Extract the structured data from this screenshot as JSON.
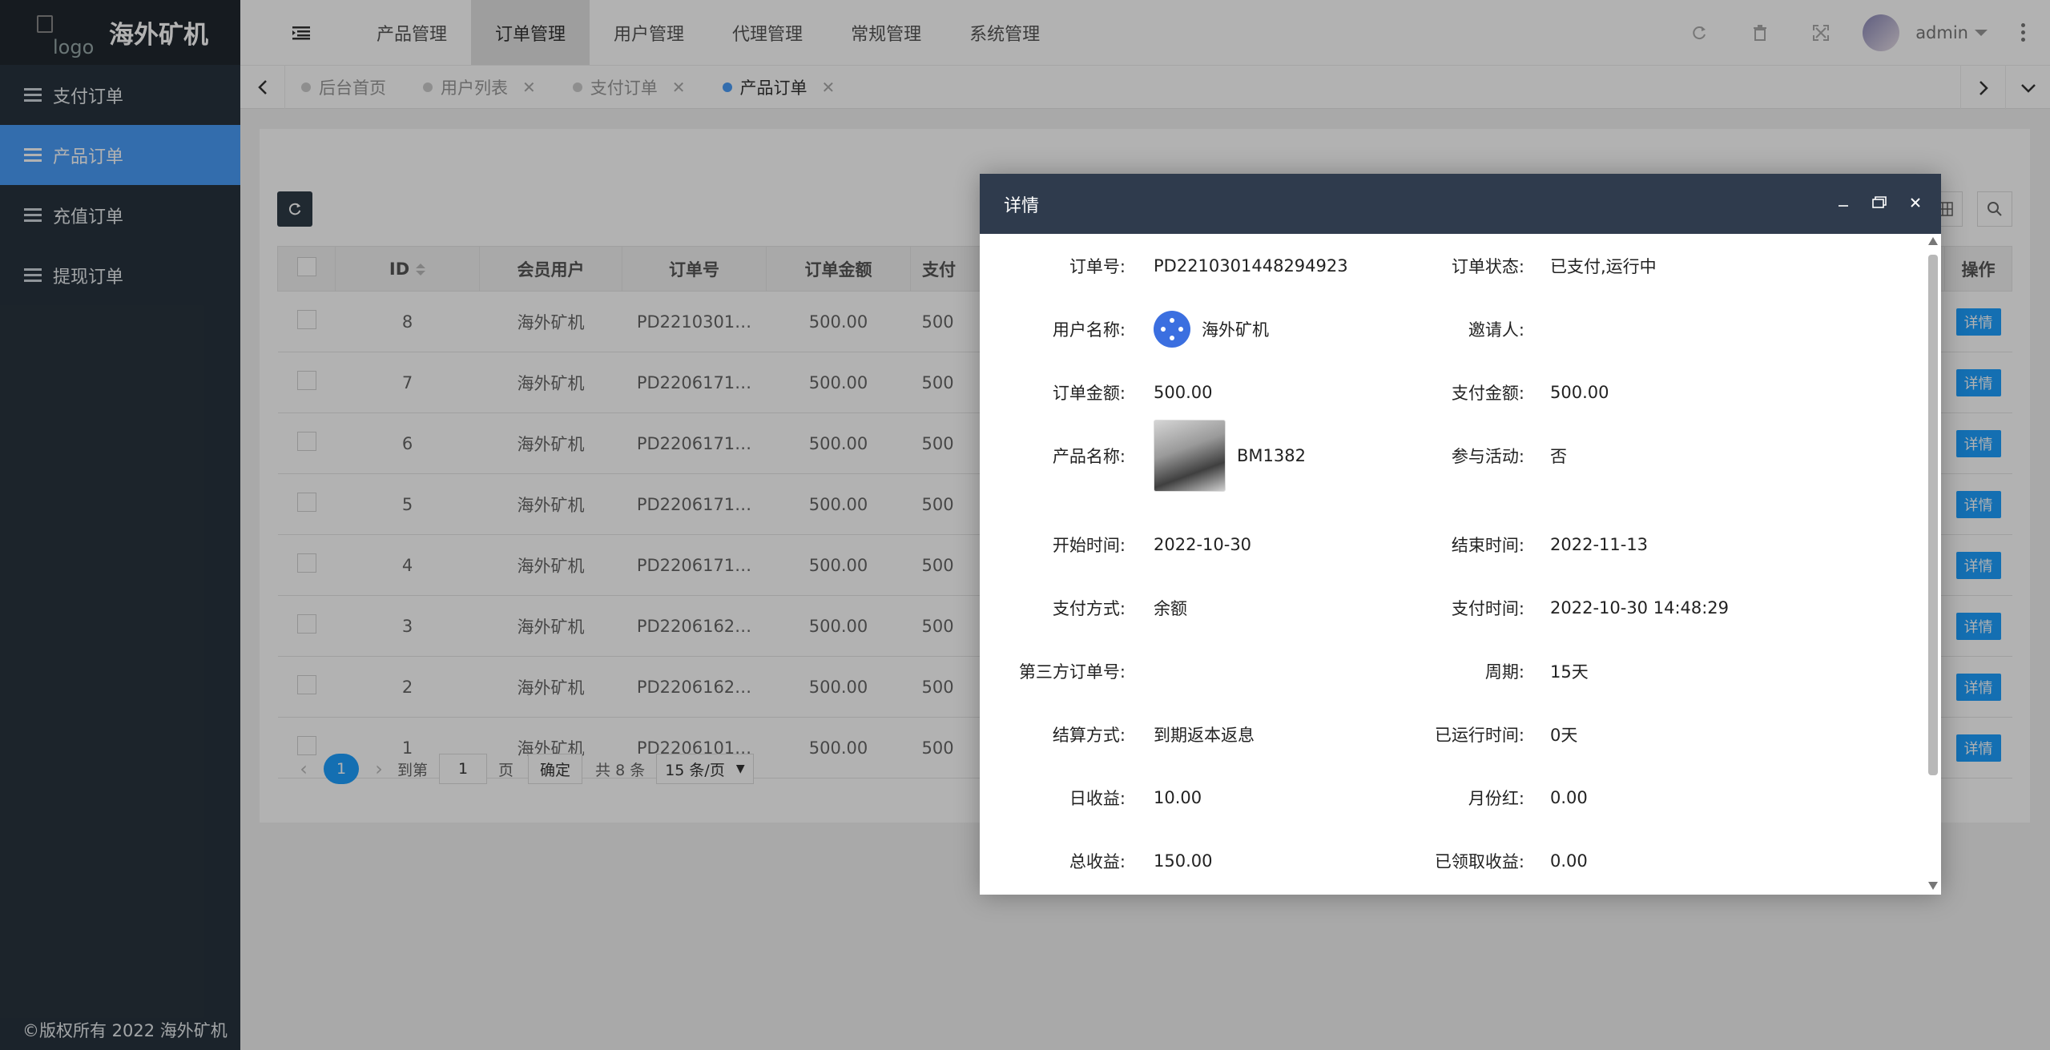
{
  "brand": {
    "logo_alt": "logo",
    "name": "海外矿机"
  },
  "sidebar": {
    "items": [
      {
        "label": "支付订单",
        "active": false
      },
      {
        "label": "产品订单",
        "active": true
      },
      {
        "label": "充值订单",
        "active": false
      },
      {
        "label": "提现订单",
        "active": false
      }
    ],
    "footer": "©版权所有 2022 海外矿机"
  },
  "topnav": {
    "items": [
      "产品管理",
      "订单管理",
      "用户管理",
      "代理管理",
      "常规管理",
      "系统管理"
    ],
    "active": "订单管理",
    "user": "admin"
  },
  "tabs": [
    {
      "label": "后台首页",
      "closable": false,
      "active": false
    },
    {
      "label": "用户列表",
      "closable": true,
      "active": false
    },
    {
      "label": "支付订单",
      "closable": true,
      "active": false
    },
    {
      "label": "产品订单",
      "closable": true,
      "active": true
    }
  ],
  "table": {
    "headers": {
      "id": "ID",
      "user": "会员用户",
      "order_no": "订单号",
      "amount": "订单金额",
      "pay": "支付",
      "action": "操作"
    },
    "detail_label": "详情",
    "rows": [
      {
        "id": "8",
        "user": "海外矿机",
        "order_no": "PD2210301…",
        "amount": "500.00",
        "pay": "500"
      },
      {
        "id": "7",
        "user": "海外矿机",
        "order_no": "PD2206171…",
        "amount": "500.00",
        "pay": "500"
      },
      {
        "id": "6",
        "user": "海外矿机",
        "order_no": "PD2206171…",
        "amount": "500.00",
        "pay": "500"
      },
      {
        "id": "5",
        "user": "海外矿机",
        "order_no": "PD2206171…",
        "amount": "500.00",
        "pay": "500"
      },
      {
        "id": "4",
        "user": "海外矿机",
        "order_no": "PD2206171…",
        "amount": "500.00",
        "pay": "500"
      },
      {
        "id": "3",
        "user": "海外矿机",
        "order_no": "PD2206162…",
        "amount": "500.00",
        "pay": "500"
      },
      {
        "id": "2",
        "user": "海外矿机",
        "order_no": "PD2206162…",
        "amount": "500.00",
        "pay": "500"
      },
      {
        "id": "1",
        "user": "海外矿机",
        "order_no": "PD2206101…",
        "amount": "500.00",
        "pay": "500"
      }
    ]
  },
  "pager": {
    "current": "1",
    "goto_label": "到第",
    "goto_value": "1",
    "page_label": "页",
    "confirm": "确定",
    "total": "共 8 条",
    "page_size": "15 条/页"
  },
  "modal": {
    "title": "详情",
    "fields": [
      {
        "l1": "订单号:",
        "v1": "PD2210301448294923",
        "l2": "订单状态:",
        "v2": "已支付,运行中"
      },
      {
        "l1": "用户名称:",
        "v1": "海外矿机",
        "l2": "邀请人:",
        "v2": ""
      },
      {
        "l1": "订单金额:",
        "v1": "500.00",
        "l2": "支付金额:",
        "v2": "500.00"
      },
      {
        "l1": "产品名称:",
        "v1": "BM1382",
        "l2": "参与活动:",
        "v2": "否"
      },
      {
        "l1": "开始时间:",
        "v1": "2022-10-30",
        "l2": "结束时间:",
        "v2": "2022-11-13"
      },
      {
        "l1": "支付方式:",
        "v1": "余额",
        "l2": "支付时间:",
        "v2": "2022-10-30 14:48:29"
      },
      {
        "l1": "第三方订单号:",
        "v1": "",
        "l2": "周期:",
        "v2": "15天"
      },
      {
        "l1": "结算方式:",
        "v1": "到期返本返息",
        "l2": "已运行时间:",
        "v2": "0天"
      },
      {
        "l1": "日收益:",
        "v1": "10.00",
        "l2": "月份红:",
        "v2": "0.00"
      },
      {
        "l1": "总收益:",
        "v1": "150.00",
        "l2": "已领取收益:",
        "v2": "0.00"
      }
    ]
  },
  "colors": {
    "accent": "#4a9df8",
    "sidebar": "#28333e",
    "modal_head": "#2f3b4d",
    "button": "#1e9fff"
  }
}
